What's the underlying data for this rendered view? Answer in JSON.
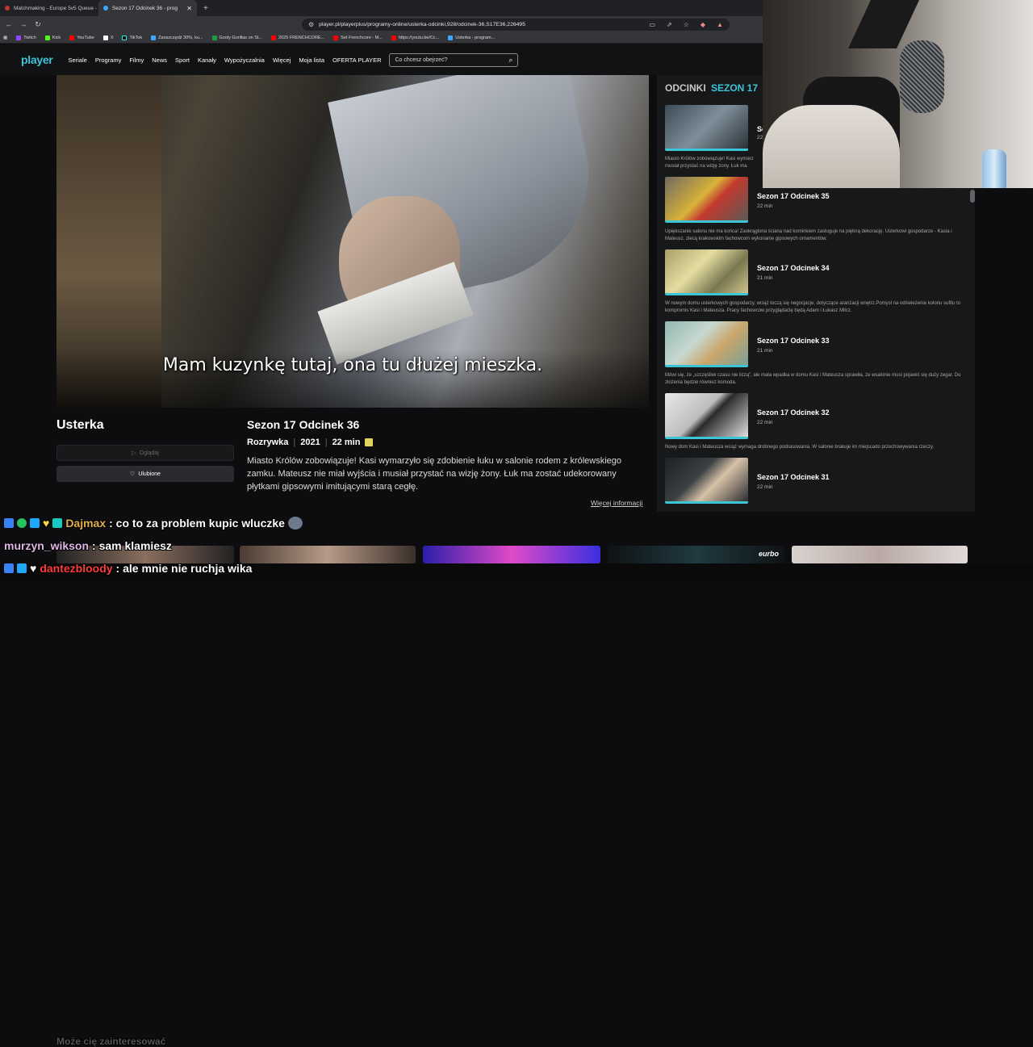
{
  "browser": {
    "tabs": [
      {
        "label": "Matchmaking - Europe 5v5 Queue -",
        "active": false
      },
      {
        "label": "Sezon 17 Odcinek 36 - prog",
        "active": true
      }
    ],
    "new_tab": "+",
    "url": "player.pl/playerplus/programy-online/usterka-odcinki,928/odcinek-36,S17E36,226495",
    "bookmarks": [
      {
        "label": "Twitch",
        "color": "#9146ff"
      },
      {
        "label": "Kick",
        "color": "#53fc18"
      },
      {
        "label": "YouTube",
        "color": "#ff0000"
      },
      {
        "label": "X",
        "color": "#ffffff"
      },
      {
        "label": "TikTok",
        "color": "#111111"
      },
      {
        "label": "Zaoszczędź 30%, ku...",
        "color": "#3ea6ff"
      },
      {
        "label": "Gooly Gorillas on St...",
        "color": "#1b9e3e"
      },
      {
        "label": "2025 FRENCHCORE...",
        "color": "#ff0000"
      },
      {
        "label": "Set Frenchcore - M...",
        "color": "#ff0000"
      },
      {
        "label": "https://youtu.be/Cc...",
        "color": "#ff0000"
      },
      {
        "label": "Usterka - program...",
        "color": "#3ea6ff"
      }
    ]
  },
  "site": {
    "logo": "player",
    "nav": [
      "Seriale",
      "Programy",
      "Filmy",
      "News",
      "Sport",
      "Kanały",
      "Wypożyczalnia",
      "Więcej",
      "Moja lista",
      "OFERTA PLAYER"
    ],
    "search_placeholder": "Co chcesz obejrzeć?"
  },
  "player": {
    "subtitle": "Mam kuzynkę tutaj, ona tu dłużej mieszka."
  },
  "show": {
    "title": "Usterka",
    "watch_label": "Oglądaj",
    "fav_label": "Ulubione"
  },
  "episode": {
    "title": "Sezon 17 Odcinek 36",
    "genre": "Rozrywka",
    "year": "2021",
    "duration": "22 min",
    "description": "Miasto Królów zobowiązuje! Kasi wymarzyło się zdobienie łuku w salonie rodem z królewskiego zamku. Mateusz nie miał wyjścia i musiał przystać na wizję żony. Łuk ma zostać udekorowany płytkami gipsowymi imitującymi starą cegłę.",
    "more_info": "Więcej informacji"
  },
  "episodes_panel": {
    "heading": "ODCINKI",
    "season": "SEZON 17",
    "items": [
      {
        "name": "Sezon 17 Odcinek 36",
        "short_name": "Se",
        "length": "22",
        "summary": "Miasto Królów zobowiązuje! Kasi wymarz",
        "summary2": "musiał przystać na wizję żony. Łuk ma",
        "thumb": "#5a7a8c"
      },
      {
        "name": "Sezon 17 Odcinek 35",
        "length": "22 min",
        "summary": "Upiększanie salonu nie ma końca! Zaokrąglona ściana nad kominkiem zasługuje na piękną dekorację. Usterkowi gospodarze - Kasia i Mateusz, zlecą krakowskim fachowcom wykonanie gipsowych ornamentów.",
        "thumb": "#c8a23c"
      },
      {
        "name": "Sezon 17 Odcinek 34",
        "length": "21 min",
        "summary": "W nowym domu usterkowych gospodarzy, wciąż toczą się negocjacje, dotyczące aranżacji wnętrz.Pomysł na odświeżenie kolonu sufitu to kompromis Kasi i Mateusza. Pracy fachowców przyglądaćię będą Adam i Łukasz Milcz.",
        "thumb": "#c9c07a"
      },
      {
        "name": "Sezon 17 Odcinek 33",
        "length": "21 min",
        "summary": "Mówi się, że „szczęśliwi czasu nie liczą”, ale mała wpadka w domu Kasi i Mateusza sprawiła, że wsalonie musi pojawić się duży zegar. Do złożenia będzie również komoda.",
        "thumb": "#8fb5a8"
      },
      {
        "name": "Sezon 17 Odcinek 32",
        "length": "22 min",
        "summary": "Nowy dom Kasi i Mateusza wciąż wymaga drobnego podrasowania. W salonie brakuje im miejscado przechowywania rzeczy.",
        "thumb": "#dcdcdc"
      },
      {
        "name": "Sezon 17 Odcinek 31",
        "length": "22 min",
        "summary": "",
        "thumb": "#2a2d30"
      }
    ]
  },
  "chat": {
    "faded_text": "Może cię zainteresować",
    "messages": [
      {
        "user": "Dajmax",
        "user_color": "#e3b04b",
        "text": ": co to za problem kupic wluczke"
      },
      {
        "user": "murzyn_wikson",
        "user_color": "#e0b6e6",
        "text": ": sam klamiesz"
      },
      {
        "user": "dantezbloody",
        "user_color": "#ff3b3b",
        "text": ": ale mnie nie ruchja wika"
      }
    ]
  },
  "recommendations": [
    {
      "badge": "",
      "color": "#6b5a4e"
    },
    {
      "badge": "",
      "color": "#7a5f54"
    },
    {
      "badge": "",
      "color": "#5a2fd0"
    },
    {
      "badge": "eurbo",
      "color": "#1f2a2e"
    },
    {
      "badge": "",
      "color": "#c9c3c0"
    }
  ],
  "colors": {
    "accent": "#3cc5d6",
    "header_bg": "#111214",
    "panel_bg": "#17181a"
  }
}
